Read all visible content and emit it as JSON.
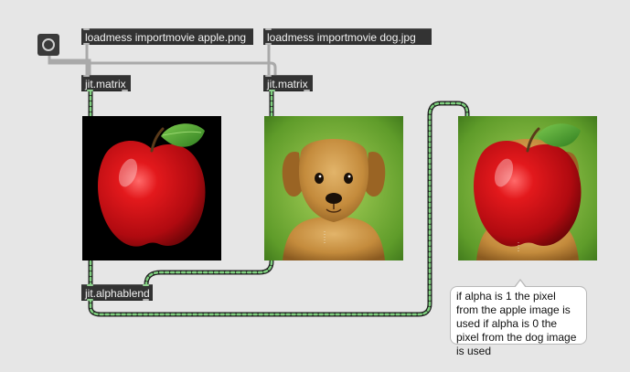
{
  "patcher": {
    "background": "#e6e6e6",
    "message_apple": "loadmess importmovie apple.png",
    "message_dog": "loadmess importmovie dog.jpg",
    "matrix_left": "jit.matrix",
    "matrix_right": "jit.matrix",
    "alphablend": "jit.alphablend",
    "comment": "if alpha is 1 the pixel from the apple image is used if alpha is 0 the pixel from the dog image is used",
    "object_color": "#333333",
    "jitter_cord_color": "#7ed07e",
    "control_cord_color": "#a5a5a5"
  },
  "icons": {
    "loadbang": "loadbang-button-icon",
    "apple": "apple-image",
    "dog": "dog-image",
    "blend": "blended-apple-dog-image"
  }
}
